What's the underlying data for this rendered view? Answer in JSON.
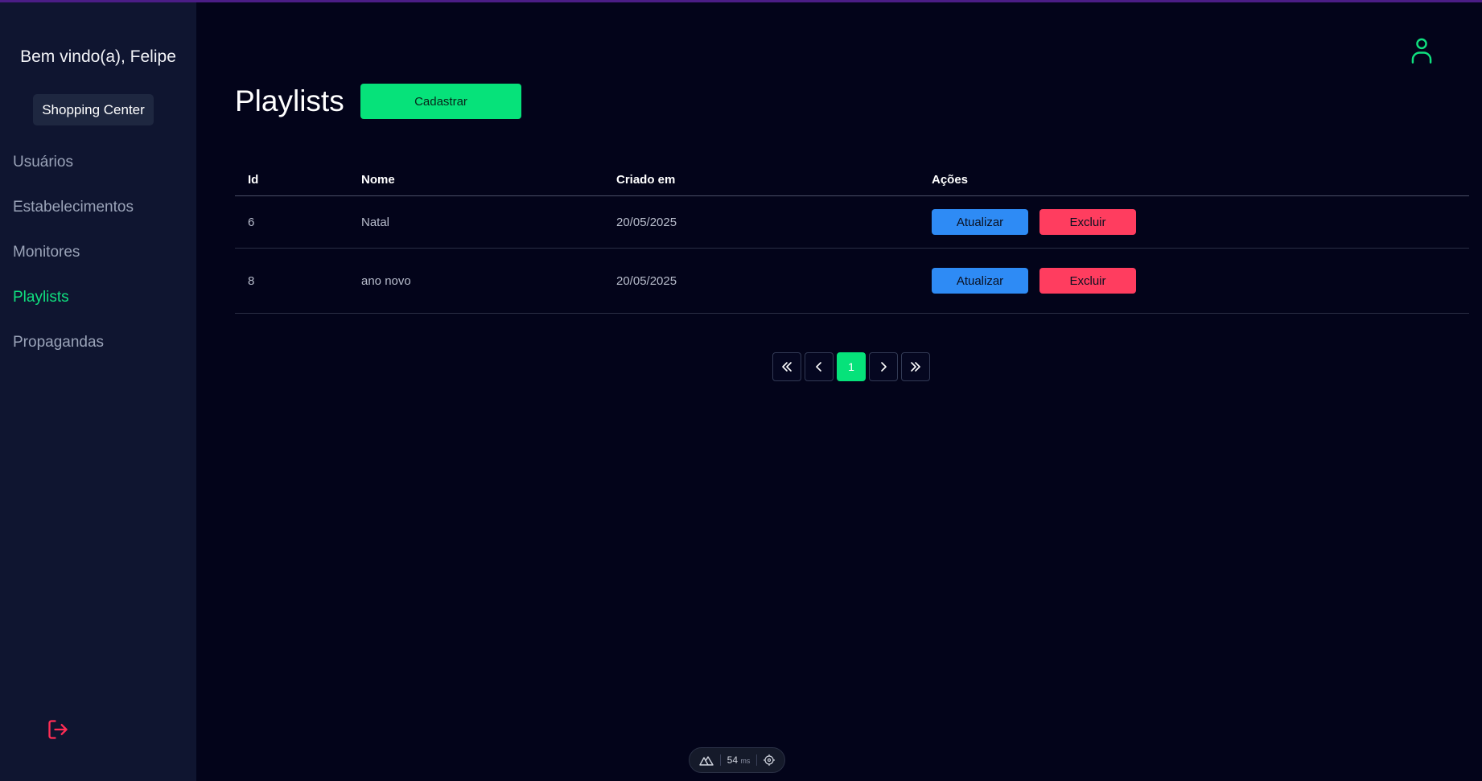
{
  "sidebar": {
    "welcome": "Bem vindo(a), Felipe",
    "establishment": "Shopping Center",
    "items": [
      {
        "label": "Usuários",
        "active": false
      },
      {
        "label": "Estabelecimentos",
        "active": false
      },
      {
        "label": "Monitores",
        "active": false
      },
      {
        "label": "Playlists",
        "active": true
      },
      {
        "label": "Propagandas",
        "active": false
      }
    ],
    "logout_icon": "logout-icon"
  },
  "header": {
    "title": "Playlists",
    "create_label": "Cadastrar",
    "user_icon": "user-icon"
  },
  "table": {
    "columns": [
      "Id",
      "Nome",
      "Criado em",
      "Ações"
    ],
    "rows": [
      {
        "id": "6",
        "name": "Natal",
        "created": "20/05/2025",
        "update_label": "Atualizar",
        "delete_label": "Excluir"
      },
      {
        "id": "8",
        "name": "ano novo",
        "created": "20/05/2025",
        "update_label": "Atualizar",
        "delete_label": "Excluir"
      }
    ]
  },
  "pagination": {
    "current_page": "1",
    "icons": [
      "double-chevron-left-icon",
      "chevron-left-icon",
      "chevron-right-icon",
      "double-chevron-right-icon"
    ]
  },
  "devbar": {
    "time": "54",
    "unit": "ms"
  },
  "colors": {
    "accent": "#06e27a",
    "update": "#2e8bf5",
    "delete": "#ff3d5f",
    "sidebar_bg": "#0f1530",
    "main_bg": "#03041a"
  }
}
